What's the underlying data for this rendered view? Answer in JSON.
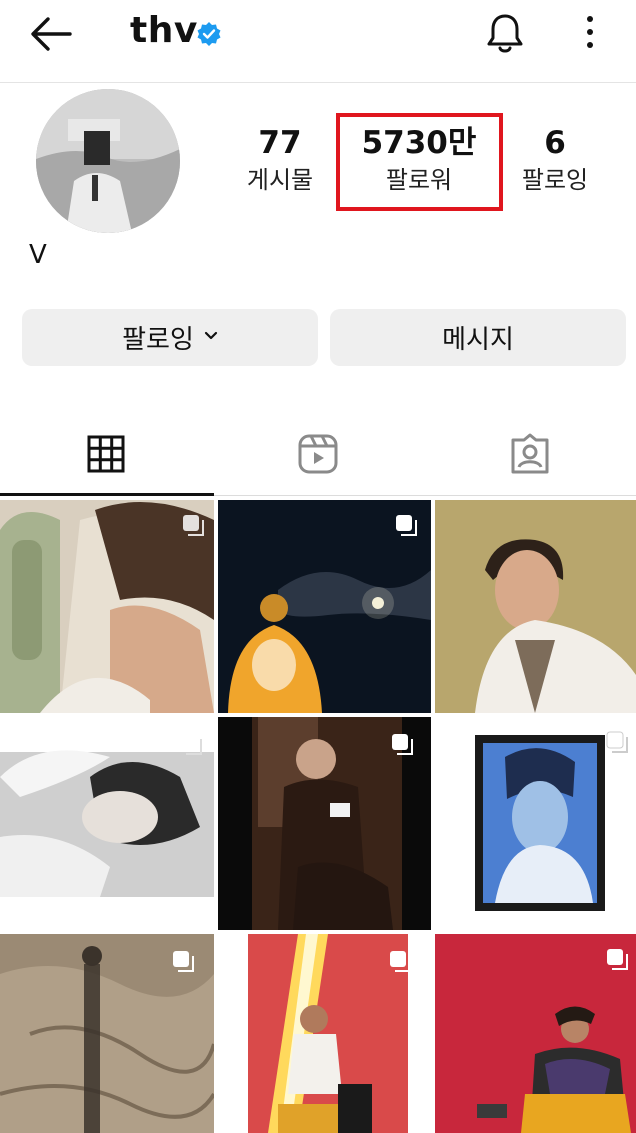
{
  "header": {
    "username": "thv",
    "verified_color": "#1d9bf0"
  },
  "profile": {
    "display_name": "V",
    "stats": [
      {
        "value": "77",
        "label": "게시물"
      },
      {
        "value": "5730만",
        "label": "팔로워"
      },
      {
        "value": "6",
        "label": "팔로잉"
      }
    ],
    "highlight_color": "#e0161e"
  },
  "actions": {
    "following_label": "팔로잉",
    "message_label": "메시지"
  },
  "tabs": [
    "grid-icon",
    "reels-icon",
    "tagged-icon"
  ],
  "icons": {
    "back": "back-arrow-icon",
    "bell": "bell-icon",
    "more": "more-vertical-icon"
  }
}
